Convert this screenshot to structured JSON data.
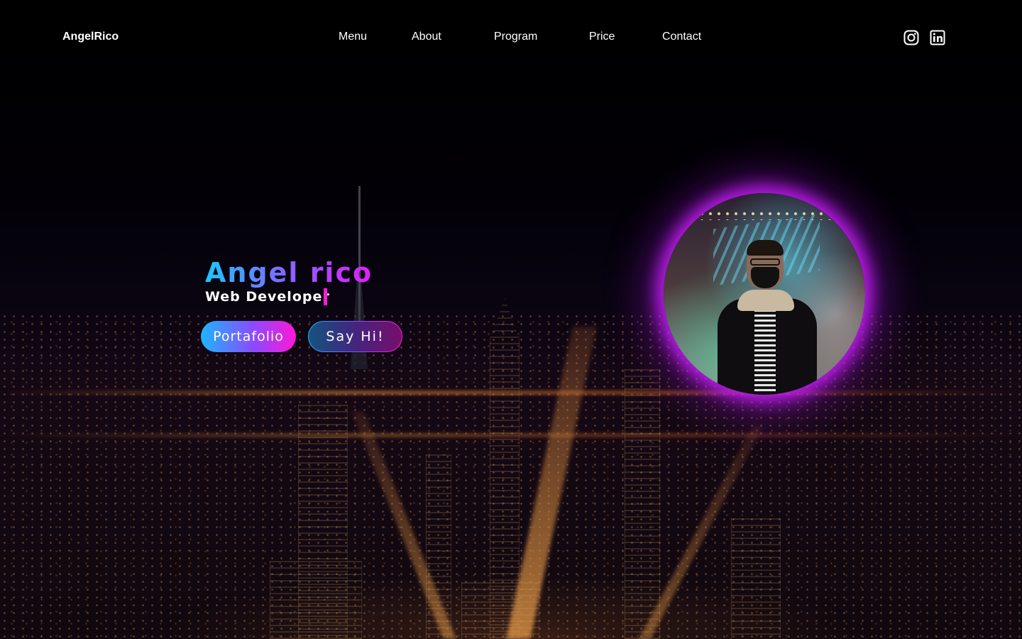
{
  "brand": {
    "logo_text": "AngelRico"
  },
  "nav": {
    "items": [
      {
        "label": "Menu"
      },
      {
        "label": "About"
      },
      {
        "label": "Program"
      },
      {
        "label": "Price"
      },
      {
        "label": "Contact"
      }
    ]
  },
  "social": {
    "instagram_icon": "instagram-icon",
    "linkedin_icon": "linkedin-icon"
  },
  "hero": {
    "name": "Angel rico",
    "role": "Web Developer",
    "primary_button": "Portafolio",
    "secondary_button": "Say Hi!"
  },
  "theme": {
    "gradient_start": "#1cc6ff",
    "gradient_mid": "#8a4bff",
    "gradient_end": "#ff17d6",
    "avatar_glow": "#cd1eff",
    "background": "#000000"
  }
}
